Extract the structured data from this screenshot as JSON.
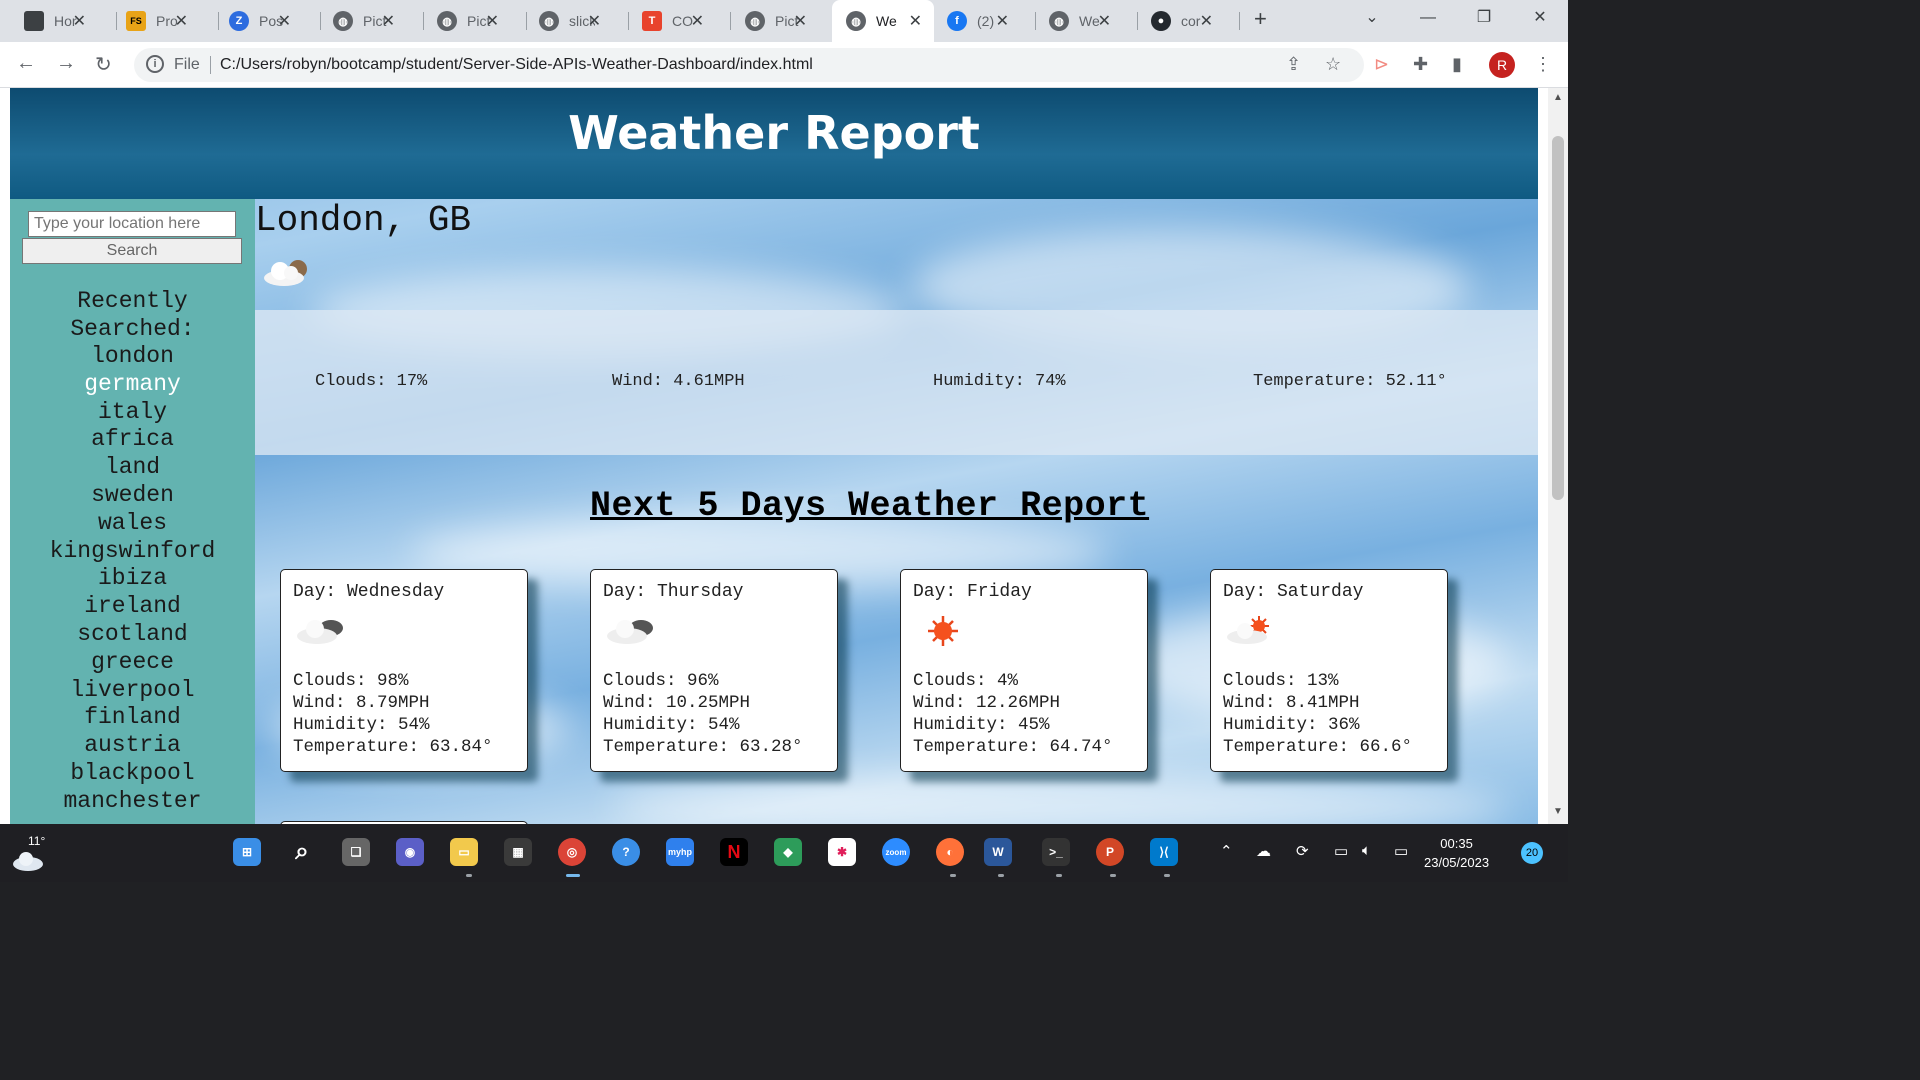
{
  "browser": {
    "tabs": [
      {
        "title": "Hor",
        "icon": "app-icon",
        "color": "#3c4043"
      },
      {
        "title": "Pro",
        "icon": "fs-icon",
        "color": "#e8a317"
      },
      {
        "title": "Pos",
        "icon": "z-icon",
        "color": "#2d6cdf"
      },
      {
        "title": "Pict",
        "icon": "globe-icon",
        "color": "#5f6368"
      },
      {
        "title": "Pict",
        "icon": "globe-icon",
        "color": "#5f6368"
      },
      {
        "title": "slick",
        "icon": "globe-icon",
        "color": "#5f6368"
      },
      {
        "title": "CO",
        "icon": "t-icon",
        "color": "#e8432d"
      },
      {
        "title": "Pict",
        "icon": "globe-icon",
        "color": "#5f6368"
      },
      {
        "title": "We",
        "icon": "globe-icon",
        "color": "#5f6368",
        "active": true
      },
      {
        "title": "(2)",
        "icon": "facebook-icon",
        "color": "#1877f2"
      },
      {
        "title": "We",
        "icon": "globe-icon",
        "color": "#5f6368"
      },
      {
        "title": "cor",
        "icon": "github-icon",
        "color": "#24292f"
      }
    ],
    "address": {
      "scheme_label": "File",
      "url": "C:/Users/robyn/bootcamp/student/Server-Side-APIs-Weather-Dashboard/index.html"
    },
    "profile_initial": "R"
  },
  "page": {
    "title": "Weather Report",
    "search": {
      "placeholder": "Type your location here",
      "button_label": "Search"
    },
    "recent": {
      "heading_line1": "Recently",
      "heading_line2": "Searched:",
      "items": [
        "london",
        "germany",
        "italy",
        "africa",
        "land",
        "sweden",
        "wales",
        "kingswinford",
        "ibiza",
        "ireland",
        "scotland",
        "greece",
        "liverpool",
        "finland",
        "austria",
        "blackpool",
        "manchester"
      ]
    },
    "current": {
      "city": "London, GB",
      "icon": "cloudy-icon",
      "clouds": "Clouds: 17%",
      "wind": "Wind: 4.61MPH",
      "humidity": "Humidity: 74%",
      "temperature": "Temperature: 52.11°"
    },
    "forecast_title": "Next 5 Days Weather Report",
    "forecast": [
      {
        "day": "Day: Wednesday",
        "icon": "cloud-icon",
        "clouds": "Clouds: 98%",
        "wind": "Wind: 8.79MPH",
        "humidity": "Humidity: 54%",
        "temperature": "Temperature: 63.84°"
      },
      {
        "day": "Day: Thursday",
        "icon": "cloud-icon",
        "clouds": "Clouds: 96%",
        "wind": "Wind: 10.25MPH",
        "humidity": "Humidity: 54%",
        "temperature": "Temperature: 63.28°"
      },
      {
        "day": "Day: Friday",
        "icon": "sun-icon",
        "clouds": "Clouds: 4%",
        "wind": "Wind: 12.26MPH",
        "humidity": "Humidity: 45%",
        "temperature": "Temperature: 64.74°"
      },
      {
        "day": "Day: Saturday",
        "icon": "partly-sunny-icon",
        "clouds": "Clouds: 13%",
        "wind": "Wind: 8.41MPH",
        "humidity": "Humidity: 36%",
        "temperature": "Temperature: 66.6°"
      }
    ]
  },
  "taskbar": {
    "weather_temp": "11°",
    "time": "00:35",
    "date": "23/05/2023",
    "notifications": "20"
  },
  "colors": {
    "header": "#0d4b70",
    "sidebar": "#63b3b0",
    "recent_highlight": "#ffffff"
  }
}
